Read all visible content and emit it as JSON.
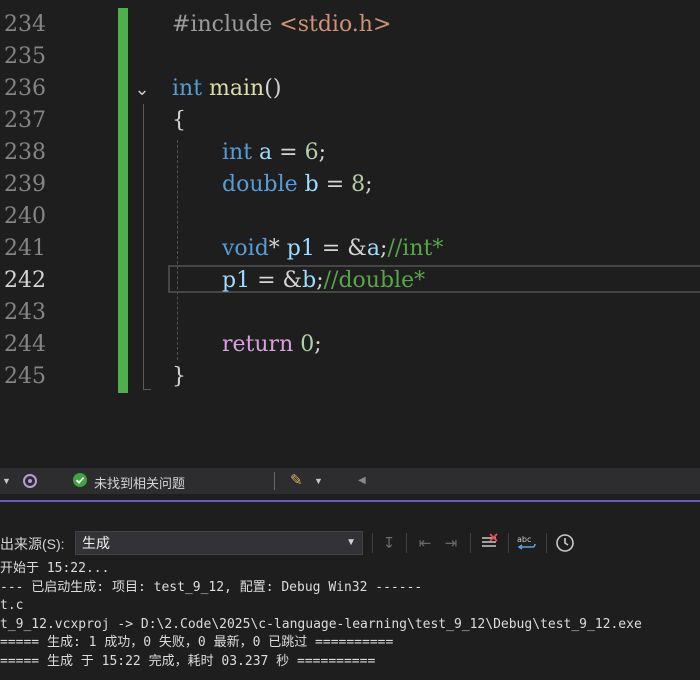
{
  "editor": {
    "lines": [
      {
        "num": "234",
        "tokens": [
          [
            "pre",
            "#include "
          ],
          [
            "str",
            "<stdio.h>"
          ]
        ]
      },
      {
        "num": "235",
        "tokens": []
      },
      {
        "num": "236",
        "tokens": [
          [
            "kw",
            "int"
          ],
          [
            "op",
            " "
          ],
          [
            "fn",
            "main"
          ],
          [
            "op",
            "()"
          ]
        ]
      },
      {
        "num": "237",
        "tokens": [
          [
            "op",
            "{"
          ]
        ]
      },
      {
        "num": "238",
        "tokens": [
          [
            "kw",
            "int"
          ],
          [
            "op",
            " "
          ],
          [
            "var",
            "a"
          ],
          [
            "op",
            " = "
          ],
          [
            "num",
            "6"
          ],
          [
            "op",
            ";"
          ]
        ]
      },
      {
        "num": "239",
        "tokens": [
          [
            "kw",
            "double"
          ],
          [
            "op",
            " "
          ],
          [
            "var",
            "b"
          ],
          [
            "op",
            " = "
          ],
          [
            "num",
            "8"
          ],
          [
            "op",
            ";"
          ]
        ]
      },
      {
        "num": "240",
        "tokens": []
      },
      {
        "num": "241",
        "tokens": [
          [
            "kw",
            "void"
          ],
          [
            "op",
            "* "
          ],
          [
            "var",
            "p1"
          ],
          [
            "op",
            " = &"
          ],
          [
            "var",
            "a"
          ],
          [
            "op",
            ";"
          ],
          [
            "cmt",
            "//int*"
          ]
        ]
      },
      {
        "num": "242",
        "tokens": [
          [
            "var",
            "p1"
          ],
          [
            "op",
            " = &"
          ],
          [
            "var",
            "b"
          ],
          [
            "op",
            ";"
          ],
          [
            "cmt",
            "//double*"
          ]
        ]
      },
      {
        "num": "243",
        "tokens": []
      },
      {
        "num": "244",
        "tokens": [
          [
            "kw2",
            "return"
          ],
          [
            "op",
            " "
          ],
          [
            "num",
            "0"
          ],
          [
            "op",
            ";"
          ]
        ]
      },
      {
        "num": "245",
        "tokens": [
          [
            "op",
            "}"
          ]
        ]
      }
    ],
    "active_line": "242"
  },
  "statusbar": {
    "issues_text": "未找到相关问题"
  },
  "output": {
    "source_label": "出来源(S):",
    "source_value": "生成",
    "lines": [
      "开始于 15:22...",
      "--- 已启动生成: 项目: test_9_12, 配置: Debug Win32 ------",
      "t.c",
      "t_9_12.vcxproj -> D:\\2.Code\\2025\\c-language-learning\\test_9_12\\Debug\\test_9_12.exe",
      "===== 生成: 1 成功，0 失败，0 最新，0 已跳过 ==========",
      "===== 生成 于 15:22 完成，耗时 03.237 秒 =========="
    ]
  },
  "colors": {
    "change_bar": "#4eb04d",
    "accent_divider": "#6c5bb7",
    "keyword": "#569cd6",
    "comment": "#57a64a"
  }
}
